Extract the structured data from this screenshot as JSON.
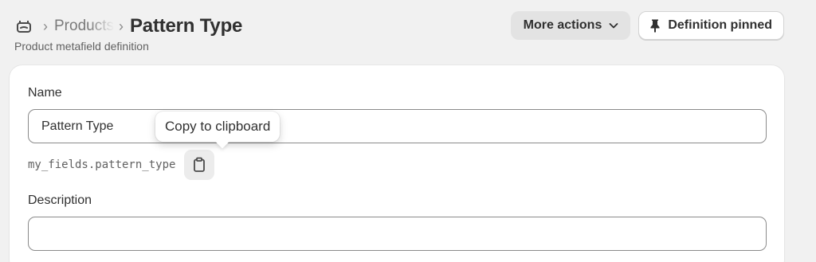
{
  "header": {
    "breadcrumb_previous": "Products",
    "title": "Pattern Type",
    "subtitle": "Product metafield definition",
    "more_actions_label": "More actions",
    "pinned_label": "Definition pinned"
  },
  "form": {
    "name_label": "Name",
    "name_value": "Pattern Type",
    "namespace_key": "my_fields.pattern_type",
    "description_label": "Description",
    "description_value": ""
  },
  "tooltip": {
    "text": "Copy to clipboard"
  },
  "icons": {
    "home": "metafields-icon",
    "more": "chevron-down-icon",
    "pin": "pin-icon",
    "copy": "clipboard-icon"
  },
  "colors": {
    "page_background": "#f1f1f1",
    "card_background": "#ffffff",
    "text_primary": "#303030",
    "text_secondary": "#616161"
  }
}
